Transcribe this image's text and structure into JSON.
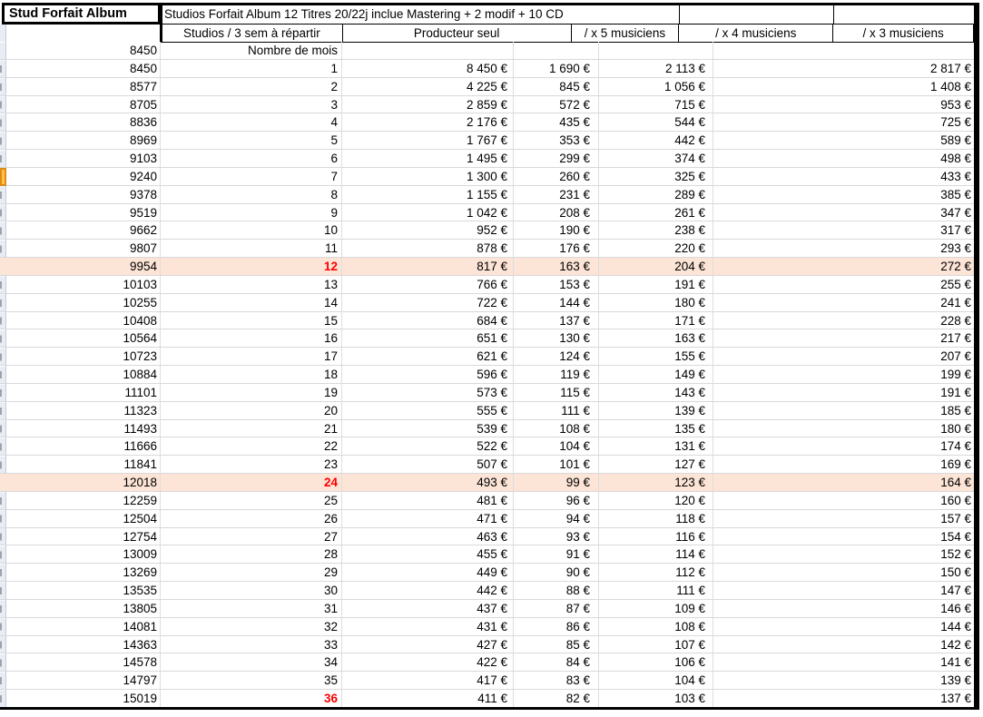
{
  "sheet": {
    "corner_title": "Stud Forfait Album",
    "main_title": "Studios Forfait Album 12 Titres 20/22j inclue Mastering + 2 modif + 10 CD",
    "columns": {
      "studios": "Studios / 3 sem à répartir",
      "producer": "Producteur seul",
      "x5": "/ x 5 musiciens",
      "x4": "/ x 4 musiciens",
      "x3": "/ x 3 musiciens"
    },
    "base_amount": "8450",
    "months_label": "Nombre de mois",
    "colors": {
      "highlight_row": "#FCE4D6",
      "red_text": "#FF0000",
      "selected_row_marker_fill": "#FFC33C",
      "selected_row_marker_border": "#E08A1E"
    },
    "rows": [
      {
        "a": "8450",
        "m": "1",
        "solo": "8 450 €",
        "x5": "1 690 €",
        "x4": "2 113 €",
        "x3": "2 817 €",
        "hl": false,
        "red": false
      },
      {
        "a": "8577",
        "m": "2",
        "solo": "4 225 €",
        "x5": "845 €",
        "x4": "1 056 €",
        "x3": "1 408 €",
        "hl": false,
        "red": false
      },
      {
        "a": "8705",
        "m": "3",
        "solo": "2 859 €",
        "x5": "572 €",
        "x4": "715 €",
        "x3": "953 €",
        "hl": false,
        "red": false
      },
      {
        "a": "8836",
        "m": "4",
        "solo": "2 176 €",
        "x5": "435 €",
        "x4": "544 €",
        "x3": "725 €",
        "hl": false,
        "red": false
      },
      {
        "a": "8969",
        "m": "5",
        "solo": "1 767 €",
        "x5": "353 €",
        "x4": "442 €",
        "x3": "589 €",
        "hl": false,
        "red": false
      },
      {
        "a": "9103",
        "m": "6",
        "solo": "1 495 €",
        "x5": "299 €",
        "x4": "374 €",
        "x3": "498 €",
        "hl": false,
        "red": false
      },
      {
        "a": "9240",
        "m": "7",
        "solo": "1 300 €",
        "x5": "260 €",
        "x4": "325 €",
        "x3": "433 €",
        "hl": false,
        "red": false
      },
      {
        "a": "9378",
        "m": "8",
        "solo": "1 155 €",
        "x5": "231 €",
        "x4": "289 €",
        "x3": "385 €",
        "hl": false,
        "red": false
      },
      {
        "a": "9519",
        "m": "9",
        "solo": "1 042 €",
        "x5": "208 €",
        "x4": "261 €",
        "x3": "347 €",
        "hl": false,
        "red": false
      },
      {
        "a": "9662",
        "m": "10",
        "solo": "952 €",
        "x5": "190 €",
        "x4": "238 €",
        "x3": "317 €",
        "hl": false,
        "red": false
      },
      {
        "a": "9807",
        "m": "11",
        "solo": "878 €",
        "x5": "176 €",
        "x4": "220 €",
        "x3": "293 €",
        "hl": false,
        "red": false
      },
      {
        "a": "9954",
        "m": "12",
        "solo": "817 €",
        "x5": "163 €",
        "x4": "204 €",
        "x3": "272 €",
        "hl": true,
        "red": true
      },
      {
        "a": "10103",
        "m": "13",
        "solo": "766 €",
        "x5": "153 €",
        "x4": "191 €",
        "x3": "255 €",
        "hl": false,
        "red": false
      },
      {
        "a": "10255",
        "m": "14",
        "solo": "722 €",
        "x5": "144 €",
        "x4": "180 €",
        "x3": "241 €",
        "hl": false,
        "red": false
      },
      {
        "a": "10408",
        "m": "15",
        "solo": "684 €",
        "x5": "137 €",
        "x4": "171 €",
        "x3": "228 €",
        "hl": false,
        "red": false
      },
      {
        "a": "10564",
        "m": "16",
        "solo": "651 €",
        "x5": "130 €",
        "x4": "163 €",
        "x3": "217 €",
        "hl": false,
        "red": false
      },
      {
        "a": "10723",
        "m": "17",
        "solo": "621 €",
        "x5": "124 €",
        "x4": "155 €",
        "x3": "207 €",
        "hl": false,
        "red": false
      },
      {
        "a": "10884",
        "m": "18",
        "solo": "596 €",
        "x5": "119 €",
        "x4": "149 €",
        "x3": "199 €",
        "hl": false,
        "red": false
      },
      {
        "a": "11101",
        "m": "19",
        "solo": "573 €",
        "x5": "115 €",
        "x4": "143 €",
        "x3": "191 €",
        "hl": false,
        "red": false
      },
      {
        "a": "11323",
        "m": "20",
        "solo": "555 €",
        "x5": "111 €",
        "x4": "139 €",
        "x3": "185 €",
        "hl": false,
        "red": false
      },
      {
        "a": "11493",
        "m": "21",
        "solo": "539 €",
        "x5": "108 €",
        "x4": "135 €",
        "x3": "180 €",
        "hl": false,
        "red": false
      },
      {
        "a": "11666",
        "m": "22",
        "solo": "522 €",
        "x5": "104 €",
        "x4": "131 €",
        "x3": "174 €",
        "hl": false,
        "red": false
      },
      {
        "a": "11841",
        "m": "23",
        "solo": "507 €",
        "x5": "101 €",
        "x4": "127 €",
        "x3": "169 €",
        "hl": false,
        "red": false
      },
      {
        "a": "12018",
        "m": "24",
        "solo": "493 €",
        "x5": "99 €",
        "x4": "123 €",
        "x3": "164 €",
        "hl": true,
        "red": true
      },
      {
        "a": "12259",
        "m": "25",
        "solo": "481 €",
        "x5": "96 €",
        "x4": "120 €",
        "x3": "160 €",
        "hl": false,
        "red": false
      },
      {
        "a": "12504",
        "m": "26",
        "solo": "471 €",
        "x5": "94 €",
        "x4": "118 €",
        "x3": "157 €",
        "hl": false,
        "red": false
      },
      {
        "a": "12754",
        "m": "27",
        "solo": "463 €",
        "x5": "93 €",
        "x4": "116 €",
        "x3": "154 €",
        "hl": false,
        "red": false
      },
      {
        "a": "13009",
        "m": "28",
        "solo": "455 €",
        "x5": "91 €",
        "x4": "114 €",
        "x3": "152 €",
        "hl": false,
        "red": false
      },
      {
        "a": "13269",
        "m": "29",
        "solo": "449 €",
        "x5": "90 €",
        "x4": "112 €",
        "x3": "150 €",
        "hl": false,
        "red": false
      },
      {
        "a": "13535",
        "m": "30",
        "solo": "442 €",
        "x5": "88 €",
        "x4": "111 €",
        "x3": "147 €",
        "hl": false,
        "red": false
      },
      {
        "a": "13805",
        "m": "31",
        "solo": "437 €",
        "x5": "87 €",
        "x4": "109 €",
        "x3": "146 €",
        "hl": false,
        "red": false
      },
      {
        "a": "14081",
        "m": "32",
        "solo": "431 €",
        "x5": "86 €",
        "x4": "108 €",
        "x3": "144 €",
        "hl": false,
        "red": false
      },
      {
        "a": "14363",
        "m": "33",
        "solo": "427 €",
        "x5": "85 €",
        "x4": "107 €",
        "x3": "142 €",
        "hl": false,
        "red": false
      },
      {
        "a": "14578",
        "m": "34",
        "solo": "422 €",
        "x5": "84 €",
        "x4": "106 €",
        "x3": "141 €",
        "hl": false,
        "red": false
      },
      {
        "a": "14797",
        "m": "35",
        "solo": "417 €",
        "x5": "83 €",
        "x4": "104 €",
        "x3": "139 €",
        "hl": false,
        "red": false
      },
      {
        "a": "15019",
        "m": "36",
        "solo": "411 €",
        "x5": "82 €",
        "x4": "103 €",
        "x3": "137 €",
        "hl": false,
        "red": true
      }
    ]
  }
}
